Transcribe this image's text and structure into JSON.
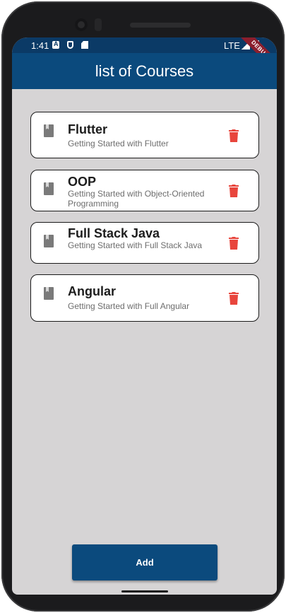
{
  "status_bar": {
    "time": "1:41",
    "network": "LTE",
    "ribbon": "DEBUG"
  },
  "appbar": {
    "title": "list of Courses"
  },
  "courses": [
    {
      "title": "Flutter",
      "subtitle": "Getting Started with Flutter",
      "icon": "book-icon",
      "action_icon": "trash-icon"
    },
    {
      "title": "OOP",
      "subtitle": "Getting Started with Object-Oriented Programming",
      "icon": "book-icon",
      "action_icon": "trash-icon"
    },
    {
      "title": "Full Stack Java",
      "subtitle": "Getting Started with Full Stack Java",
      "icon": "book-icon",
      "action_icon": "trash-icon"
    },
    {
      "title": "Angular",
      "subtitle": "Getting Started with Full Angular",
      "icon": "book-icon",
      "action_icon": "trash-icon"
    }
  ],
  "add_button": {
    "label": "Add"
  },
  "colors": {
    "primary": "#0b4a7d",
    "status_bar": "#0b3a66",
    "background": "#d6d4d5",
    "delete": "#e8453c",
    "book_icon": "#7a7a7a"
  }
}
